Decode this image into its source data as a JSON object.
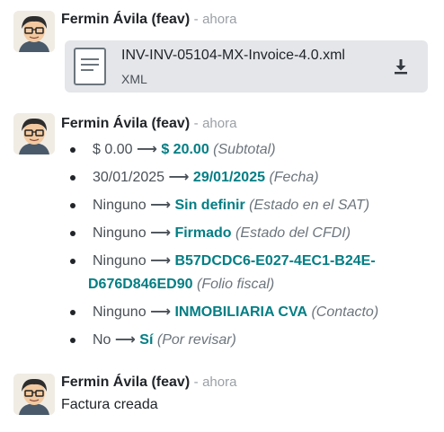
{
  "messages": [
    {
      "author": "Fermin Ávila (feav)",
      "separator": "-",
      "time": "ahora",
      "attachment": {
        "name": "INV-INV-05104-MX-Invoice-4.0.xml",
        "type": "XML",
        "action_icon": "download-icon"
      }
    },
    {
      "author": "Fermin Ávila (feav)",
      "separator": "-",
      "time": "ahora",
      "arrow": "⟶",
      "changes": [
        {
          "old": "$ 0.00",
          "new": "$ 20.00",
          "field": "(Subtotal)"
        },
        {
          "old": "30/01/2025",
          "new": "29/01/2025",
          "field": "(Fecha)"
        },
        {
          "old": "Ninguno",
          "new": "Sin definir",
          "field": "(Estado en el SAT)"
        },
        {
          "old": "Ninguno",
          "new": "Firmado",
          "field": "(Estado del CFDI)"
        },
        {
          "old": "Ninguno",
          "new_line1": "B57DCDC6-E027-4EC1-B24E-",
          "new_line2": "D676D846ED90",
          "field": "(Folio fiscal)"
        },
        {
          "old": "Ninguno",
          "new": "INMOBILIARIA CVA",
          "field": "(Contacto)"
        },
        {
          "old": "No",
          "new": "Sí",
          "field": "(Por revisar)"
        }
      ]
    },
    {
      "author": "Fermin Ávila (feav)",
      "separator": "-",
      "time": "ahora",
      "body": "Factura creada"
    }
  ],
  "colors": {
    "accent": "#017e84",
    "muted": "#9aa0a6",
    "attachment_bg": "#e4e6ea"
  }
}
